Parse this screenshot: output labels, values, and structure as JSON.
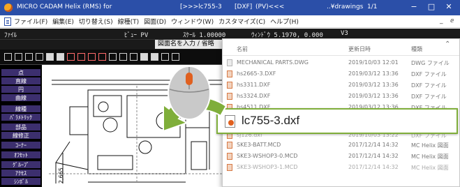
{
  "titlebar": {
    "app_title": "MICRO CADAM Helix (RMS) for",
    "path_prefix": "[>>>lc755-3",
    "format": "[DXF]",
    "mode": "(PV)<<<",
    "folder": "..¥drawings",
    "page": "1/1",
    "controls": {
      "minimize": "−",
      "maximize": "□",
      "close": "✕"
    }
  },
  "menu": {
    "items": [
      "ファイル(F)",
      "編集(E)",
      "切り替え(S)",
      "線種(T)",
      "図面(D)",
      "ウィンドウ(W)",
      "カスタマイズ(C)",
      "ヘルプ(H)"
    ],
    "mdi_controls": [
      "_",
      "ⅇ"
    ]
  },
  "status": {
    "file_label": "ﾌｧｲﾙ",
    "view_label": "ﾋﾞｭｰ PV",
    "scale_label": "ｽｹｰﾙ 1.00000",
    "window_label": "ｳｨﾝﾄﾞｳ 5.1970, 0.000",
    "v_label": "V3"
  },
  "command": {
    "prompt": "図面名を入力 / 省略"
  },
  "left_panel": {
    "buttons": [
      "点",
      "直線",
      "円",
      "曲線",
      "線種",
      "ﾊﾟﾗﾒﾄﾘｯｸ",
      "部品",
      "線修正",
      "ｺｰﾅｰ",
      "ｵﾌｾｯﾄ",
      "ｸﾞﾙｰﾌﾟ",
      "ｱｸｾｽ",
      "ｼﾝﾎﾞﾙ"
    ]
  },
  "dialog": {
    "columns": {
      "name": "名前",
      "date": "更新日時",
      "type": "種類"
    },
    "rows": [
      {
        "name": "MECHANICAL PARTS.DWG",
        "date": "2019/10/03 12:01",
        "type": "DWG ファイル"
      },
      {
        "name": "hs2665-3.DXF",
        "date": "2019/03/12 13:36",
        "type": "DXF ファイル"
      },
      {
        "name": "hs3311.DXF",
        "date": "2019/03/12 13:36",
        "type": "DXF ファイル"
      },
      {
        "name": "hs3324.DXF",
        "date": "2019/03/12 13:36",
        "type": "DXF ファイル"
      },
      {
        "name": "hs4511.DXF",
        "date": "2019/03/12 13:36",
        "type": "DXF ファイル"
      },
      {
        "name": "sj126.dxf",
        "date": "2019/10/03 13:22",
        "type": "DXF ファイル"
      },
      {
        "name": "SKE3-BATT.MCD",
        "date": "2017/12/14 14:32",
        "type": "MC Helix 図面"
      },
      {
        "name": "SKE3-WSHOP3-0.MCD",
        "date": "2017/12/14 14:32",
        "type": "MC Helix 図面"
      },
      {
        "name": "SKE3-WSHOP3-1.MCD",
        "date": "2017/12/14 14:32",
        "type": "MC Helix 図面"
      }
    ],
    "highlighted": {
      "name": "lc755-3.dxf"
    }
  },
  "drawing": {
    "dimension_label": "2,665"
  },
  "colors": {
    "titlebar": "#2b4fa8",
    "panel_button": "#3c2f6e",
    "highlight_border": "#7fae3a",
    "arrow": "#7fae3a",
    "mouse_button": "#e0601f"
  },
  "icons": {
    "app": "app-logo-icon",
    "document": "document-icon",
    "mouse": "mouse-icon",
    "arrow": "curved-arrow-icon",
    "dxf_file": "dxf-file-icon",
    "mcd_file": "mcd-file-icon",
    "dwg_file": "dwg-file-icon"
  }
}
